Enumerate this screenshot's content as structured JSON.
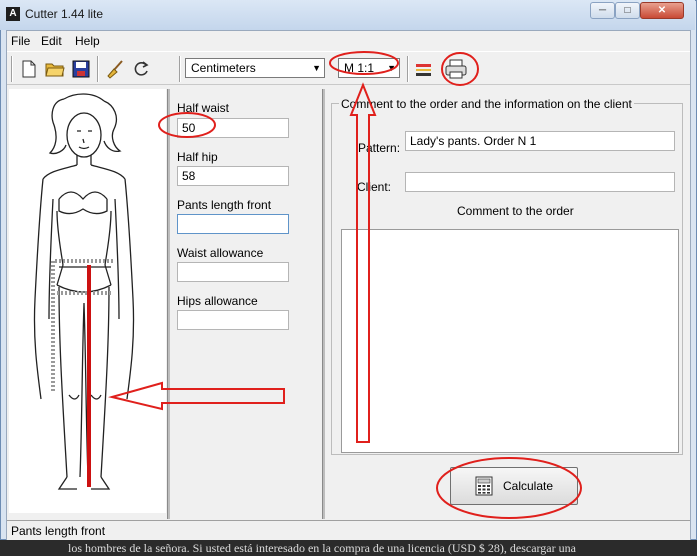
{
  "window": {
    "title": "Cutter 1.44 lite",
    "app_icon_glyph": "A"
  },
  "menu": [
    "File",
    "Edit",
    "Help"
  ],
  "toolbar": {
    "units": "Centimeters",
    "scale": "M 1:1",
    "icons": [
      "new-file-icon",
      "open-folder-icon",
      "save-icon",
      "clear-brush-icon",
      "refresh-icon",
      "ruler-settings-icon",
      "print-icon"
    ]
  },
  "form": {
    "half_waist_label": "Half waist",
    "half_waist_value": "50",
    "half_hip_label": "Half hip",
    "half_hip_value": "58",
    "pants_length_label": "Pants length front",
    "pants_length_value": "",
    "waist_allowance_label": "Waist allowance",
    "waist_allowance_value": "",
    "hips_allowance_label": "Hips allowance",
    "hips_allowance_value": ""
  },
  "order": {
    "group_title": "Comment to the order and the information on the client",
    "pattern_label": "Pattern:",
    "pattern_value": "Lady's pants. Order N 1",
    "client_label": "Client:",
    "client_value": "",
    "comment_label": "Comment to the order"
  },
  "calculate_label": "Calculate",
  "status_text": "Pants length front",
  "background_text": "los hombres de la señora. Si usted está interesado en la compra de una licencia (USD $ 28), descargar una",
  "annotation_color": "#e0201c"
}
